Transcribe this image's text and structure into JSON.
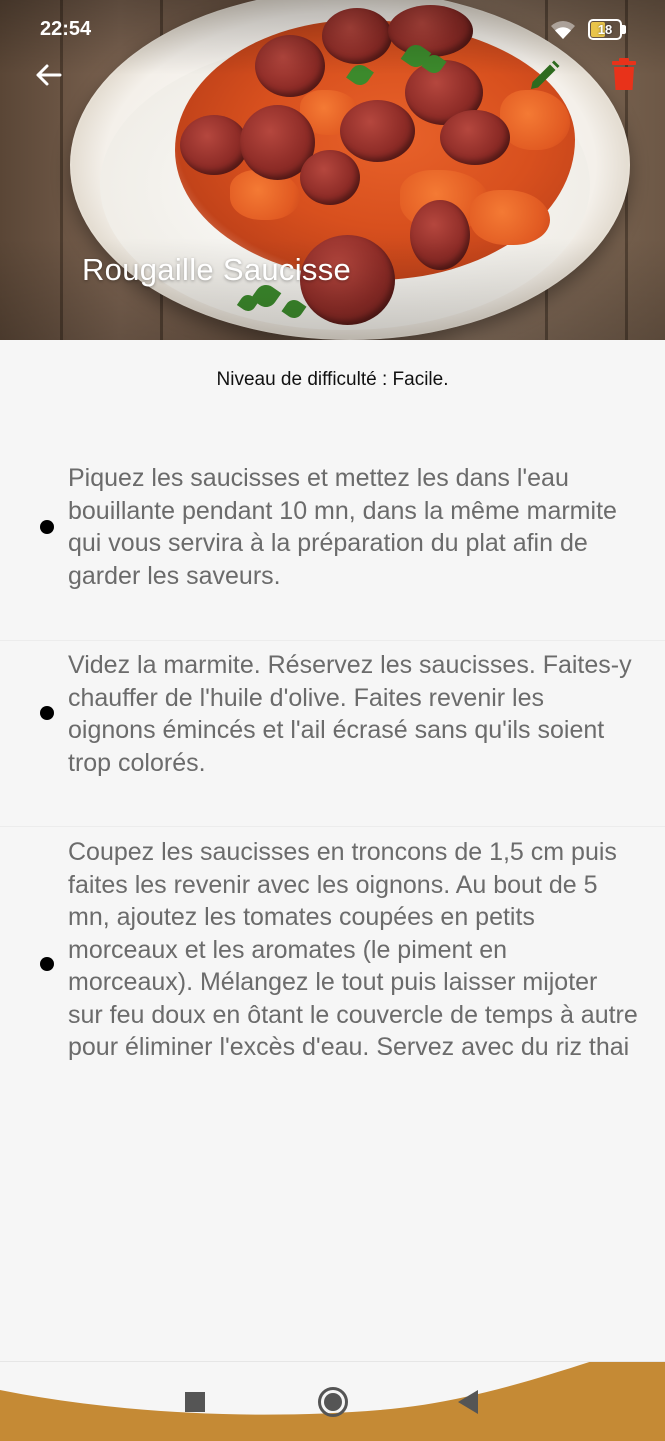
{
  "status_bar": {
    "time": "22:54",
    "battery_level": "18",
    "icons": [
      "wifi-icon",
      "battery-icon"
    ]
  },
  "app_bar": {
    "back_icon": "arrow-left-icon",
    "edit_icon": "pencil-icon",
    "delete_icon": "trash-icon",
    "edit_color": "#2e6b1f",
    "delete_color": "#e8321a"
  },
  "recipe": {
    "title": "Rougaille Saucisse",
    "difficulty": "Niveau de difficulté : Facile.",
    "steps": [
      {
        "text": "Piquez les saucisses et mettez les dans l'eau bouillante pendant 10 mn, dans la même marmite qui vous servira à la préparation du plat afin de garder les saveurs."
      },
      {
        "text": "Videz la marmite. Réservez les saucisses. Faites-y chauffer de l'huile d'olive. Faites revenir les oignons émincés et l'ail écrasé sans qu'ils soient trop colorés."
      },
      {
        "text": "Coupez les saucisses en troncons de 1,5 cm puis faites les revenir avec les oignons. Au bout de 5 mn, ajoutez les tomates coupées en petits morceaux et les aromates (le piment en morceaux). Mélangez le tout puis laisser mijoter sur feu doux en ôtant le couvercle de temps à autre pour éliminer l'excès d'eau. Servez avec du riz thai"
      }
    ]
  },
  "nav_bar": {
    "accent_color": "#c58a35",
    "icons": [
      "recent-apps-icon",
      "home-icon",
      "back-triangle-icon"
    ]
  }
}
